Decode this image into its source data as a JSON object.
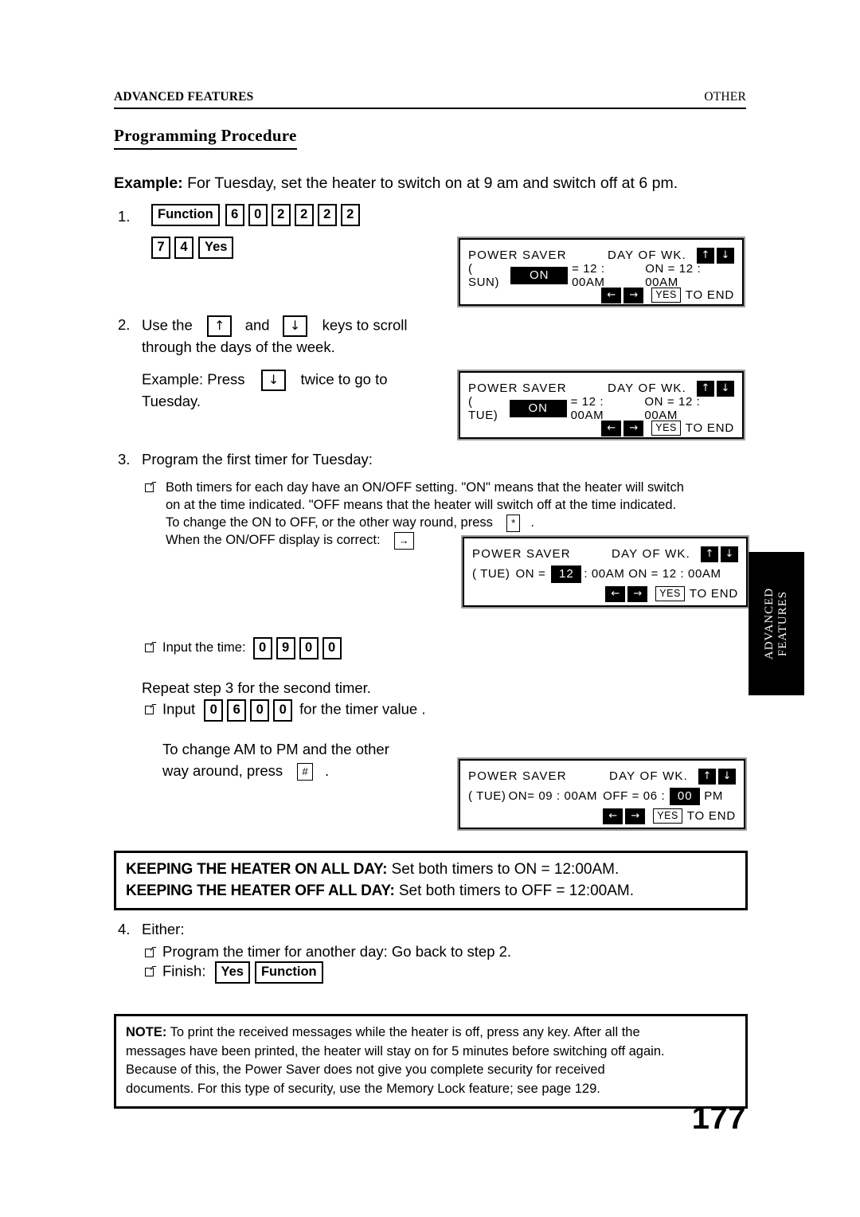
{
  "header": {
    "left": "ADVANCED FEATURES",
    "right": "OTHER"
  },
  "section_title": "Programming Procedure",
  "example": {
    "label": "Example:",
    "text": " For Tuesday, set the heater to switch on at 9 am and switch off at 6 pm."
  },
  "steps": {
    "step1": {
      "number": "1.",
      "keys_line1": [
        "Function",
        "6",
        "0",
        "2",
        "2",
        "2",
        "2"
      ],
      "keys_line2": [
        "7",
        "4",
        "Yes"
      ]
    },
    "step2": {
      "number": "2.",
      "text_a": "Use the",
      "key_up": "↑",
      "text_b": "and",
      "key_down": "↓",
      "text_c": "keys to scroll",
      "text_line2": "through the days of the week.",
      "example_a": "Example: Press",
      "example_key": "↓",
      "example_b": "twice  to go to",
      "example_line2": "Tuesday."
    },
    "step3": {
      "number": "3.",
      "heading": "Program the first timer for Tuesday:",
      "bullet1_line1": "Both timers for each day have an ON/OFF setting. \"ON\" means that the heater will switch",
      "bullet1_line2": "on at the time indicated. \"OFF means that the heater will switch off at the time indicated.",
      "bullet1_line3a": "To change the ON to OFF, or the other way round, press",
      "bullet1_key": "*",
      "bullet1_line3b": ".",
      "bullet1_line4a": "When the ON/OFF display is correct:",
      "bullet1_key2": "→",
      "bullet2_label": "Input the time:",
      "bullet2_keys": [
        "0",
        "9",
        "0",
        "0"
      ],
      "repeat_text": "Repeat step 3 for the second timer.",
      "bullet3_label": "Input",
      "bullet3_keys": [
        "0",
        "6",
        "0",
        "0"
      ],
      "bullet3_tail": "for the timer value .",
      "ampm_line1": "To change AM to PM and the other",
      "ampm_line2a": "way around, press",
      "ampm_key": "#",
      "ampm_line2b": "."
    },
    "step4": {
      "number": "4.",
      "heading": "Either:",
      "bullet1": "Program the timer for another day: Go back to step 2.",
      "bullet2_label": "Finish:",
      "bullet2_keys": [
        "Yes",
        "Function"
      ]
    }
  },
  "lcd_panels": [
    {
      "title": "POWER SAVER",
      "day_of_week_label": "DAY OF WK.",
      "up_icon": "↑",
      "down_icon": "↓",
      "day": "( SUN)",
      "field_on_off": "ON",
      "field_highlighted": "on_off",
      "eq1": "= 12 : 00AM",
      "second": "ON = 12 : 00AM",
      "left_icon": "←",
      "right_icon": "→",
      "yes_label": "YES",
      "to_end": "TO END"
    },
    {
      "title": "POWER SAVER",
      "day_of_week_label": "DAY OF WK.",
      "up_icon": "↑",
      "down_icon": "↓",
      "day": "( TUE)",
      "field_on_off": "ON",
      "field_highlighted": "on_off",
      "eq1": "= 12 : 00AM",
      "second": "ON = 12 : 00AM",
      "left_icon": "←",
      "right_icon": "→",
      "yes_label": "YES",
      "to_end": "TO END"
    },
    {
      "title": "POWER SAVER",
      "day_of_week_label": "DAY OF WK.",
      "up_icon": "↑",
      "down_icon": "↓",
      "day": "( TUE)",
      "on_label": "ON  =",
      "hour_field": "12",
      "field_highlighted": "hour",
      "rest": ": 00AM  ON = 12 : 00AM",
      "left_icon": "←",
      "right_icon": "→",
      "yes_label": "YES",
      "to_end": "TO END"
    },
    {
      "title": "POWER SAVER",
      "day_of_week_label": "DAY OF WK.",
      "up_icon": "↑",
      "down_icon": "↓",
      "day": "( TUE)",
      "on_time": "ON= 09 : 00AM",
      "off_label": "OFF = 06 :",
      "minutes_field": "00",
      "field_highlighted": "minutes",
      "ampm": "PM",
      "left_icon": "←",
      "right_icon": "→",
      "yes_label": "YES",
      "to_end": "TO END"
    }
  ],
  "side_tab": {
    "line1": "ADVANCED",
    "line2": "FEATURES"
  },
  "keeping_box": {
    "line1_head": "KEEPING THE HEATER ON ALL DAY:",
    "line1_body": " Set both timers to ON = 12:00AM.",
    "line2_head": "KEEPING THE HEATER OFF ALL DAY:",
    "line2_body": " Set both timers to OFF = 12:00AM."
  },
  "note_box": {
    "label": "NOTE:",
    "line1": " To print the received messages while the heater is off, press any key. After all the",
    "line2": "messages have been printed, the heater will stay on for 5 minutes before switching off again.",
    "line3": "Because of this, the Power Saver does not give you complete security for received",
    "line4": "documents. For this type of security, use the Memory Lock feature; see page 129."
  },
  "page_number": "177"
}
